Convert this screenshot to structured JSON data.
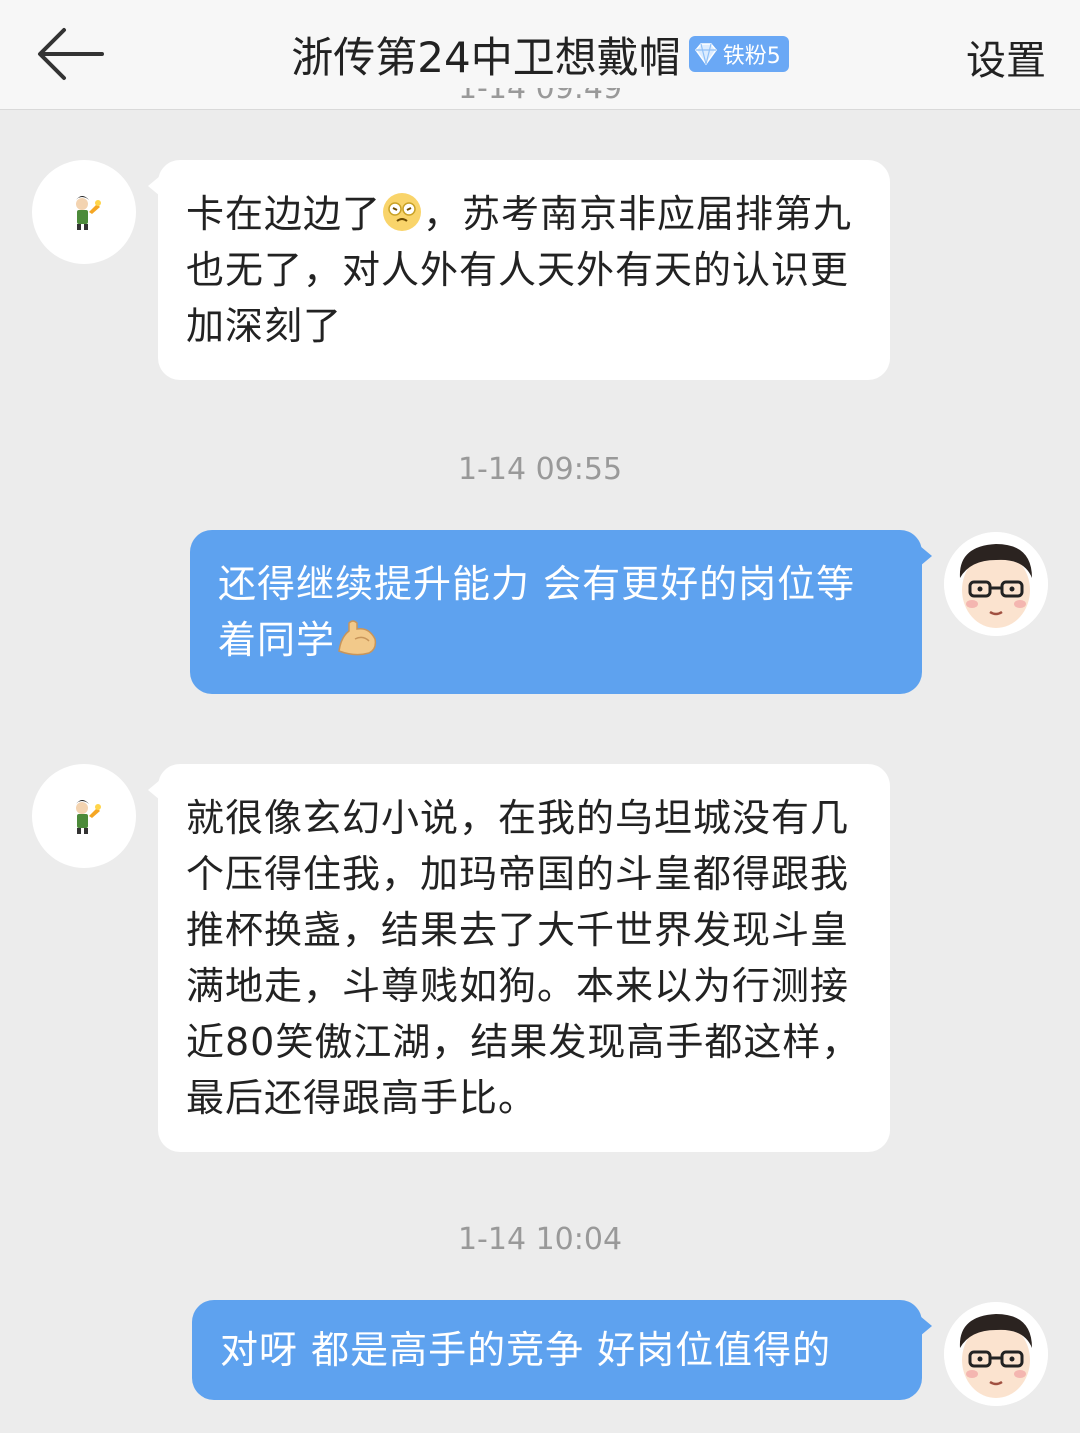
{
  "header": {
    "back_icon": "arrow-left-icon",
    "title": "浙传第24中卫想戴帽",
    "badge_label": "铁粉5",
    "badge_icon": "diamond-icon",
    "settings_label": "设置"
  },
  "colors": {
    "accent": "#5ea2ef",
    "background": "#ececec",
    "badge": "#6aa8f5"
  },
  "messages": [
    {
      "side": "left",
      "avatar": "cartoon-avatar",
      "text_before_emoji": "卡在边边了",
      "emoji": "money-face-emoji",
      "text_after_emoji": "，苏考南京非应届排第九也无了，对人外有人天外有天的认识更加深刻了"
    },
    {
      "timestamp": "1-14 09:55"
    },
    {
      "side": "right",
      "avatar": "glasses-man-avatar",
      "text": "还得继续提升能力  会有更好的岗位等着同学",
      "emoji": "flexed-biceps-emoji"
    },
    {
      "side": "left",
      "avatar": "cartoon-avatar",
      "text": "就很像玄幻小说，在我的乌坦城没有几个压得住我，加玛帝国的斗皇都得跟我推杯换盏，结果去了大千世界发现斗皇满地走，斗尊贱如狗。本来以为行测接近80笑傲江湖，结果发现高手都这样，最后还得跟高手比。"
    },
    {
      "timestamp": "1-14 10:04"
    },
    {
      "side": "right",
      "avatar": "glasses-man-avatar",
      "text": "对呀  都是高手的竞争  好岗位值得的"
    }
  ]
}
